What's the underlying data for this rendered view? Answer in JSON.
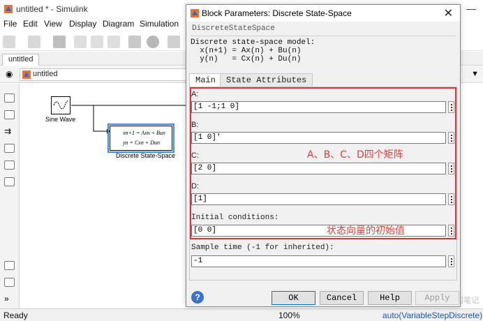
{
  "simulink": {
    "window_title": "untitled * - Simulink",
    "menu": [
      "File",
      "Edit",
      "View",
      "Display",
      "Diagram",
      "Simulation"
    ],
    "model_tab": "untitled",
    "address": "untitled",
    "status": {
      "ready": "Ready",
      "zoom": "100%",
      "solver": "auto(VariableStepDiscrete)"
    },
    "watermark": "CSDN @zevin的学习笔记",
    "blocks": {
      "sine": {
        "label": "Sine Wave"
      },
      "dss": {
        "label": "Discrete State-Space",
        "eq1": "xn+1 = Axn + Bun",
        "eq2": "yn = Cxn + Dun"
      }
    }
  },
  "dialog": {
    "title": "Block Parameters: Discrete State-Space",
    "block_type": "DiscreteStateSpace",
    "description": [
      "Discrete state-space model:",
      "  x(n+1) = Ax(n) + Bu(n)",
      "  y(n)   = Cx(n) + Du(n)"
    ],
    "tabs": [
      "Main",
      "State Attributes"
    ],
    "params": [
      {
        "label": "A:",
        "value": "[1 -1;1 0]"
      },
      {
        "label": "B:",
        "value": "[1 0]'"
      },
      {
        "label": "C:",
        "value": "[2 0]"
      },
      {
        "label": "D:",
        "value": "[1]"
      },
      {
        "label": "Initial conditions:",
        "value": "[0 0]"
      },
      {
        "label": "Sample time (-1 for inherited):",
        "value": "-1"
      }
    ],
    "annotations": {
      "matrices": "A、B、C、D四个矩阵",
      "initial": "状态向量的初始值"
    },
    "buttons": {
      "ok": "OK",
      "cancel": "Cancel",
      "help": "Help",
      "apply": "Apply"
    },
    "help_icon": "?"
  },
  "colors": {
    "highlight_border": "#e63232",
    "annotation_text": "#e83a3a",
    "selection": "#3e8ae6"
  }
}
